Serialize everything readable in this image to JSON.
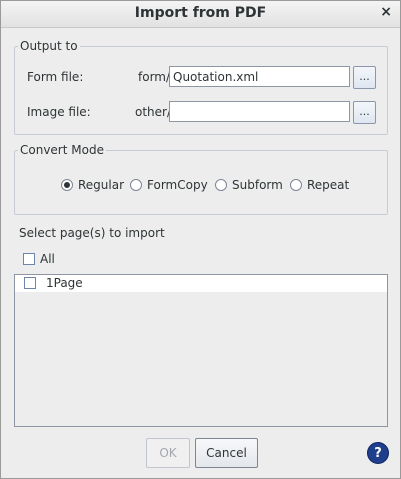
{
  "window": {
    "title": "Import from PDF",
    "close_glyph": "×"
  },
  "output_group": {
    "legend": "Output to",
    "form_file": {
      "label": "Form file:",
      "prefix": "form/",
      "value": "Quotation.xml",
      "browse": "..."
    },
    "image_file": {
      "label": "Image file:",
      "prefix": "other/",
      "value": "",
      "browse": "..."
    }
  },
  "convert_mode": {
    "legend": "Convert Mode",
    "options": [
      "Regular",
      "FormCopy",
      "Subform",
      "Repeat"
    ],
    "selected": "Regular"
  },
  "pages": {
    "heading": "Select page(s) to import",
    "all_label": "All",
    "all_checked": false,
    "items": [
      {
        "label": "1Page",
        "checked": false
      }
    ]
  },
  "buttons": {
    "ok": "OK",
    "cancel": "Cancel",
    "ok_enabled": false
  },
  "help": {
    "glyph": "?",
    "icon": "help-icon"
  }
}
